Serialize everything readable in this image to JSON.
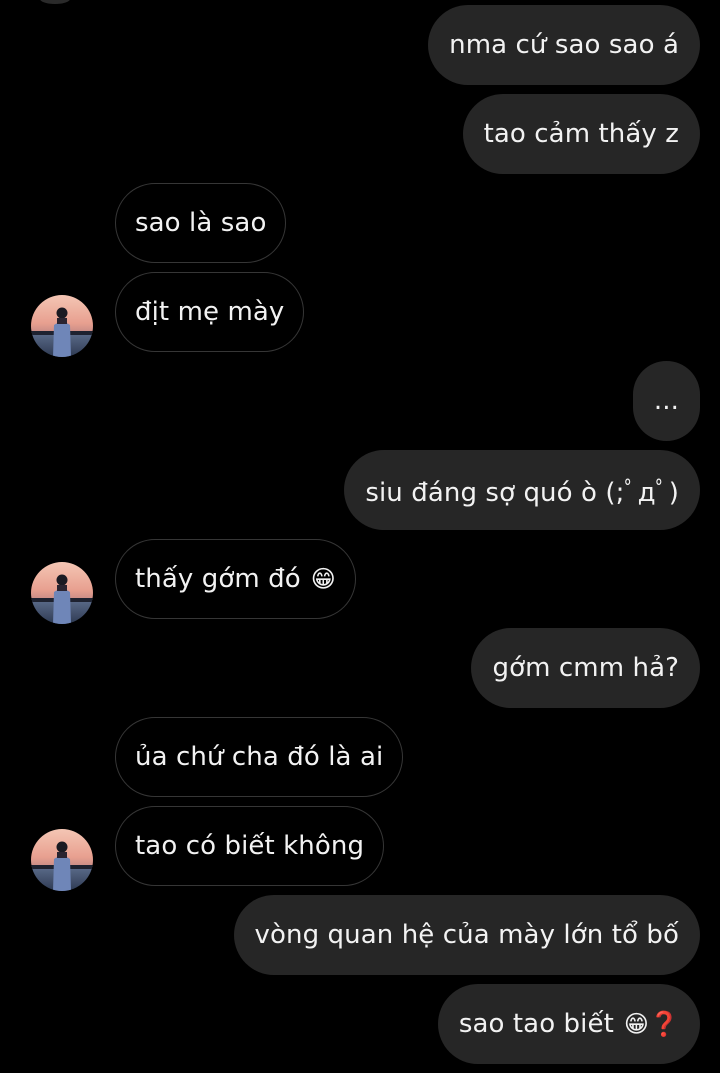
{
  "messages": [
    {
      "side": "out",
      "text": "nma cứ sao sao á"
    },
    {
      "side": "out",
      "text": "tao cảm thấy z"
    },
    {
      "side": "in",
      "text": "sao là sao"
    },
    {
      "side": "in",
      "text": "địt mẹ mày",
      "avatar": true
    },
    {
      "side": "out",
      "text": "..."
    },
    {
      "side": "out",
      "text": "siu đáng sợ quó ò (;ﾟдﾟ)"
    },
    {
      "side": "in",
      "text": "thấy gớm đó",
      "emoji": "😁",
      "avatar": true
    },
    {
      "side": "out",
      "text": "gớm cmm hả?"
    },
    {
      "side": "in",
      "text": "ủa chứ cha đó là ai"
    },
    {
      "side": "in",
      "text": "tao có biết không",
      "avatar": true
    },
    {
      "side": "out",
      "text": "vòng quan hệ của mày lớn tổ bố"
    },
    {
      "side": "out",
      "text": "sao tao biết",
      "emoji": "😁❓"
    }
  ],
  "colors": {
    "background": "#000000",
    "outgoing_bubble": "#262626",
    "incoming_border": "#363636",
    "text": "#f2f2f2"
  },
  "icons": {
    "avatar": "profile-photo-person-at-sunset-icon",
    "grin": "grinning-face-emoji-icon",
    "question": "red-question-mark-emoji-icon"
  }
}
